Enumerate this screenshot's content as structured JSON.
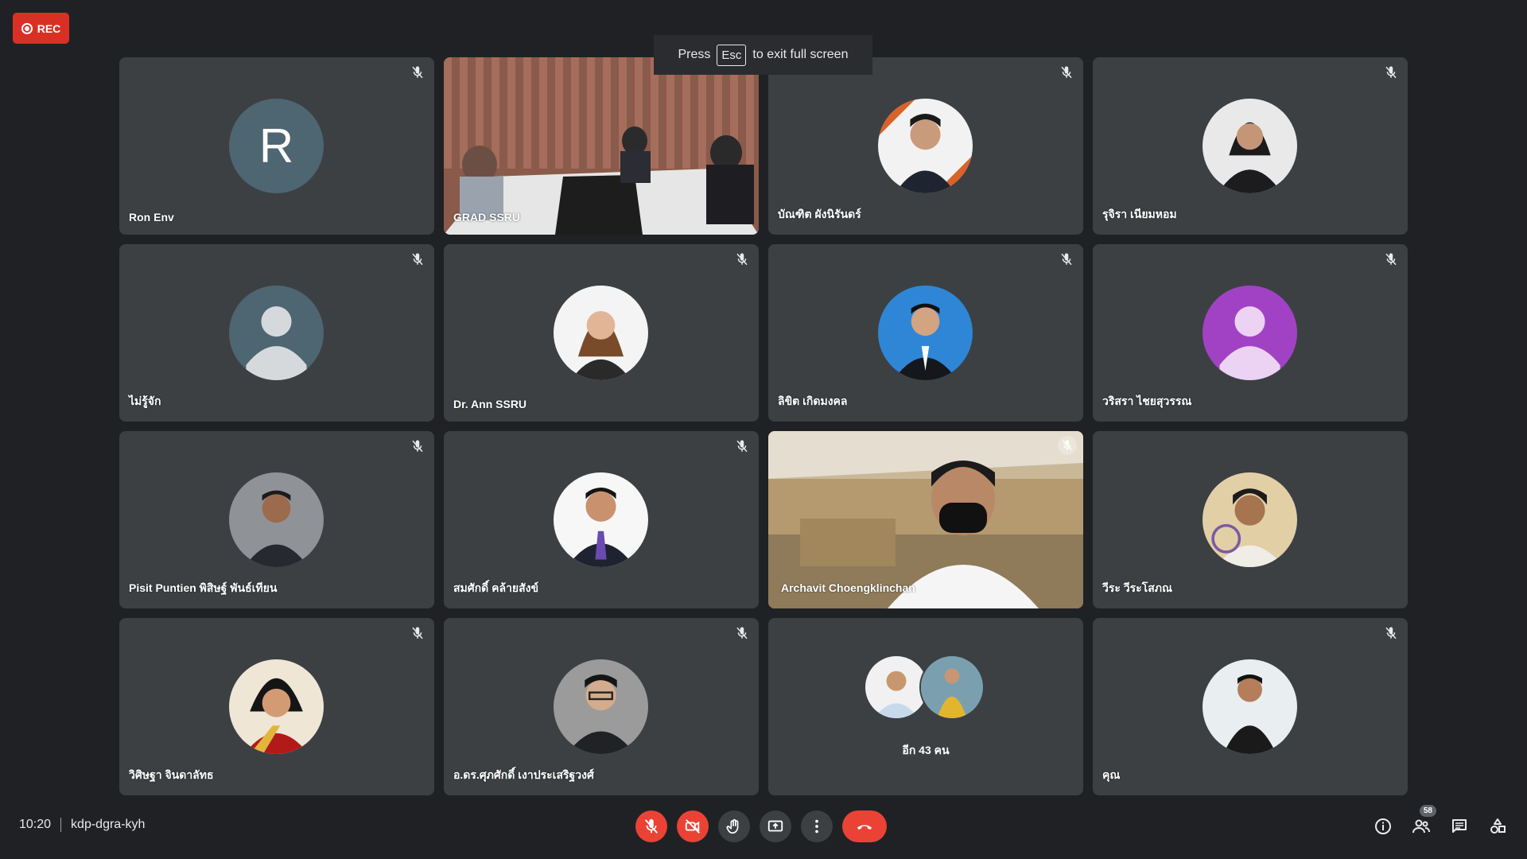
{
  "rec": {
    "label": "REC"
  },
  "toast": {
    "prefix": "Press",
    "key": "Esc",
    "suffix": "to exit full screen"
  },
  "tiles": [
    {
      "name": "Ron Env",
      "avatar_letter": "R",
      "muted": true
    },
    {
      "name": "GRAD SSRU",
      "video": true,
      "active": true
    },
    {
      "name": "บัณฑิต ผังนิรันดร์",
      "muted": true
    },
    {
      "name": "รุจิรา เนียมหอม",
      "muted": true
    },
    {
      "name": "ไม่รู้จัก",
      "muted": true
    },
    {
      "name": "Dr. Ann SSRU",
      "muted": true
    },
    {
      "name": "ลิขิต เกิดมงคล",
      "muted": true
    },
    {
      "name": "วริสรา ไชยสุวรรณ",
      "muted": true
    },
    {
      "name": "Pisit Puntien พิสิษฐ์ พันธ์เทียน",
      "muted": true
    },
    {
      "name": "สมศักดิ์ คล้ายสังข์",
      "muted": true
    },
    {
      "name": "Archavit Choengklinchan",
      "video": true,
      "muted": true
    },
    {
      "name": "วีระ วีระโสภณ",
      "muted": false
    },
    {
      "name": "วิศิษฐา จินดาลัทธ",
      "muted": true
    },
    {
      "name": "อ.ดร.ศุภศักดิ์ เงาประเสริฐวงศ์",
      "muted": true
    },
    {
      "others_label": "อีก 43 คน"
    },
    {
      "name": "คุณ",
      "muted": true
    }
  ],
  "meeting": {
    "time": "10:20",
    "code": "kdp-dgra-kyh"
  },
  "participants_count": "58",
  "colors": {
    "bg": "#202124",
    "tile": "#3c4043",
    "accent": "#8ab4f8",
    "danger": "#ea4335"
  }
}
